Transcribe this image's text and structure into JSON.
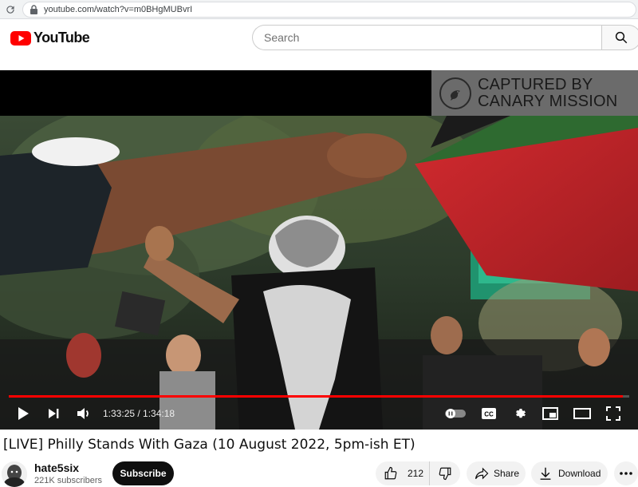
{
  "browser": {
    "url": "youtube.com/watch?v=m0BHgMUBvrI"
  },
  "header": {
    "logo_text": "YouTube",
    "search_placeholder": "Search"
  },
  "video": {
    "watermark_line1": "CAPTURED BY",
    "watermark_line2": "CANARY MISSION",
    "current_time": "1:33:25",
    "duration": "1:34:18",
    "time_display": "1:33:25 / 1:34:18",
    "progress_fraction": 0.99
  },
  "meta": {
    "title": "[LIVE] Philly Stands With Gaza (10 August 2022, 5pm-ish ET)",
    "channel_name": "hate5six",
    "subscribers": "221K subscribers",
    "subscribe_label": "Subscribe",
    "like_count": "212",
    "share_label": "Share",
    "download_label": "Download"
  },
  "colors": {
    "brand_red": "#ff0000",
    "flag_red": "#c8252a",
    "flag_green": "#3f7a38"
  }
}
